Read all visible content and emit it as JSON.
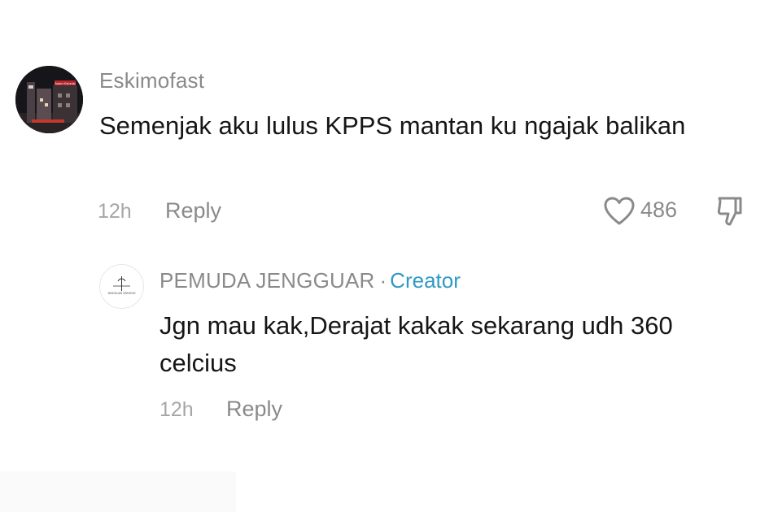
{
  "main_comment": {
    "username": "Eskimofast",
    "text": "Semenjak aku lulus KPPS mantan ku ngajak balikan",
    "time": "12h",
    "reply_label": "Reply",
    "like_count": "486",
    "avatar_sign_text": "Aston Kolonial"
  },
  "reply_comment": {
    "username": "PEMUDA JENGGUAR",
    "separator": "·",
    "badge": "Creator",
    "text": "Jgn mau kak,Derajat kakak sekarang udh 360 celcius",
    "time": "12h",
    "reply_label": "Reply",
    "avatar_logo_text": "JENGGUAR CREATIVE"
  },
  "icons": {
    "like": "heart-icon",
    "dislike": "thumbs-down-icon"
  },
  "colors": {
    "username": "#8a8a8a",
    "text": "#161616",
    "creator_badge": "#2f9ac4",
    "muted": "#a6a6a6"
  }
}
